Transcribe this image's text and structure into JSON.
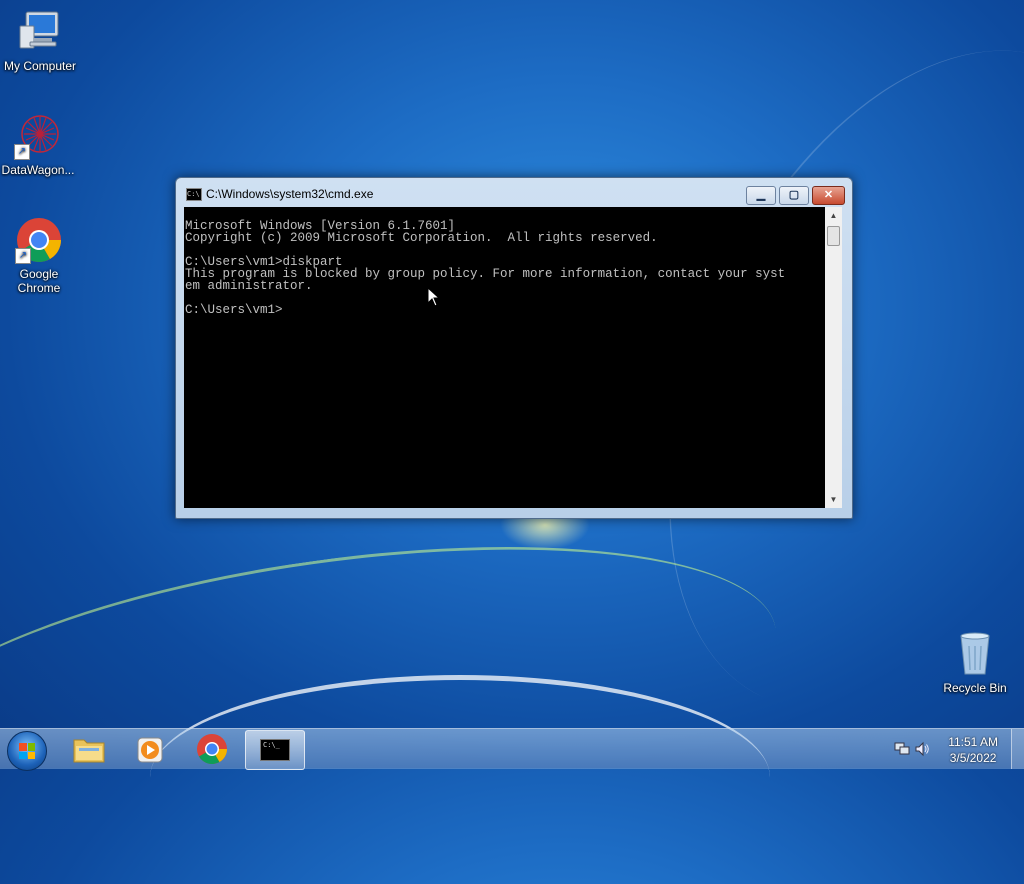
{
  "desktop": {
    "icons": [
      {
        "label": "My Computer",
        "icon": "computer-icon"
      },
      {
        "label": "DataWagon...",
        "icon": "datawagon-icon"
      },
      {
        "label": "Google Chrome",
        "icon": "chrome-icon"
      },
      {
        "label": "Recycle Bin",
        "icon": "recycle-bin-icon"
      }
    ]
  },
  "window": {
    "title": "C:\\Windows\\system32\\cmd.exe",
    "icon_text": "C:\\",
    "controls": {
      "minimize": "▁",
      "maximize": "▢",
      "close": "✕"
    },
    "console_lines": [
      "Microsoft Windows [Version 6.1.7601]",
      "Copyright (c) 2009 Microsoft Corporation.  All rights reserved.",
      "",
      "C:\\Users\\vm1>diskpart",
      "This program is blocked by group policy. For more information, contact your syst",
      "em administrator.",
      "",
      "C:\\Users\\vm1>"
    ]
  },
  "taskbar": {
    "items": [
      {
        "name": "start-button",
        "icon": "windows-logo-icon"
      },
      {
        "name": "explorer",
        "icon": "folder-icon"
      },
      {
        "name": "media-player",
        "icon": "media-player-icon"
      },
      {
        "name": "chrome",
        "icon": "chrome-icon"
      },
      {
        "name": "cmd",
        "icon": "cmd-icon",
        "label": "C:\\_"
      }
    ],
    "clock": {
      "time": "11:51 AM",
      "date": "3/5/2022"
    }
  }
}
